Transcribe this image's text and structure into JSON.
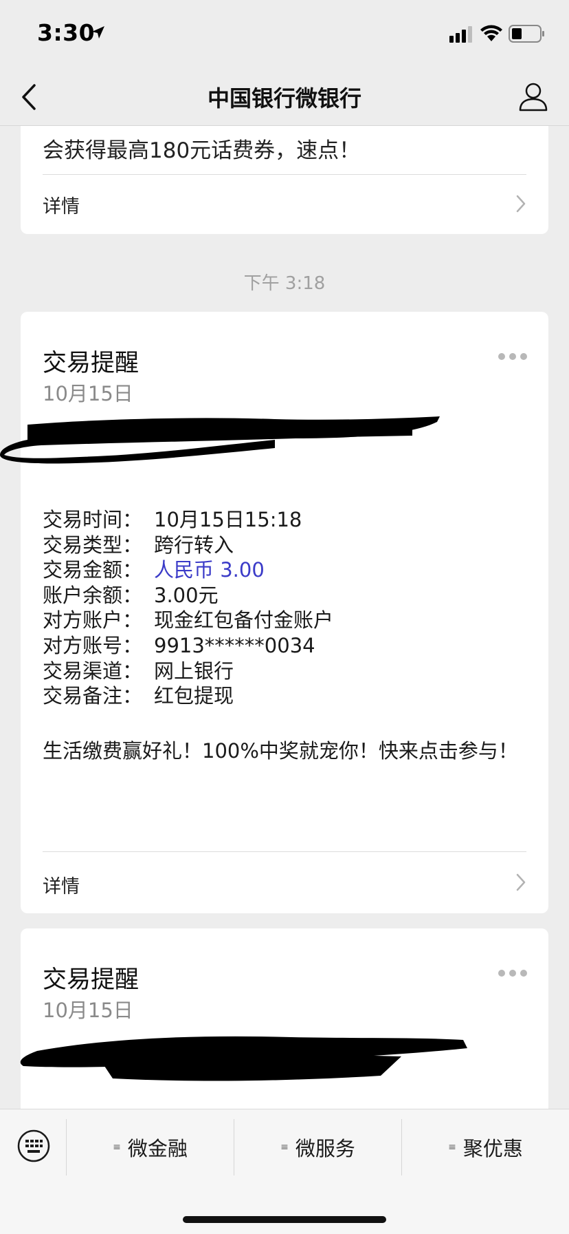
{
  "status": {
    "time": "3:30"
  },
  "nav": {
    "title": "中国银行微银行"
  },
  "messages": {
    "partial": {
      "text": "会获得最高180元话费券，速点！",
      "detail": "详情"
    },
    "timestamp": "下午 3:18",
    "card2": {
      "title": "交易提醒",
      "date": "10月15日",
      "rows": [
        {
          "label": "交易时间：",
          "value": "10月15日15:18"
        },
        {
          "label": "交易类型：",
          "value": "跨行转入"
        },
        {
          "label": "交易金额：",
          "value": "人民币 3.00"
        },
        {
          "label": "账户余额：",
          "value": "3.00元"
        },
        {
          "label": "对方账户：",
          "value": "现金红包备付金账户"
        },
        {
          "label": "对方账号：",
          "value": "9913******0034"
        },
        {
          "label": "交易渠道：",
          "value": "网上银行"
        },
        {
          "label": "交易备注：",
          "value": "红包提现"
        }
      ],
      "promo": "生活缴费赢好礼！100%中奖就宠你！快来点击参与！",
      "detail": "详情"
    },
    "card3": {
      "title": "交易提醒",
      "date": "10月15日"
    }
  },
  "tabbar": {
    "tabs": [
      "微金融",
      "微服务",
      "聚优惠"
    ]
  },
  "colors": {
    "amount": "#3b3bc8",
    "background": "#ededed"
  },
  "icons": [
    "location-arrow-icon",
    "signal-icon",
    "wifi-icon",
    "battery-icon",
    "back-chevron-icon",
    "user-icon",
    "more-dots-icon",
    "chevron-right-icon",
    "keyboard-icon",
    "menu-icon"
  ]
}
